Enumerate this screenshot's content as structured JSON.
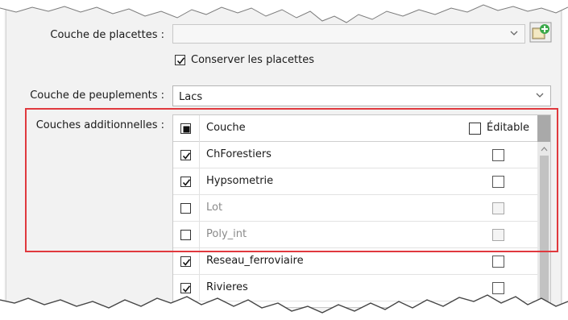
{
  "form": {
    "placettes_label": "Couche de placettes :",
    "placettes_value": "",
    "keep_label": "Conserver les placettes",
    "keep_checked": true,
    "peuplements_label": "Couche de peuplements :",
    "peuplements_value": "Lacs",
    "additional_label": "Couches additionnelles :"
  },
  "grid": {
    "header": {
      "layer_label": "Couche",
      "editable_label": "Éditable",
      "select_all_state": "indeterminate"
    },
    "rows": [
      {
        "name": "ChForestiers",
        "checked": true,
        "editable": false,
        "disabled": false
      },
      {
        "name": "Hypsometrie",
        "checked": true,
        "editable": false,
        "disabled": false
      },
      {
        "name": "Lot",
        "checked": false,
        "editable": false,
        "disabled": true
      },
      {
        "name": "Poly_int",
        "checked": false,
        "editable": false,
        "disabled": true
      },
      {
        "name": "Reseau_ferroviaire",
        "checked": true,
        "editable": false,
        "disabled": false
      },
      {
        "name": "Rivieres",
        "checked": true,
        "editable": false,
        "disabled": false
      }
    ]
  },
  "colors": {
    "highlight_border": "#e0393e",
    "panel_bg": "#f2f2f2"
  },
  "icons": {
    "add_layer": "add-layer-icon",
    "dropdown": "chevron-down-icon",
    "scroll_up": "arrow-up-icon"
  }
}
